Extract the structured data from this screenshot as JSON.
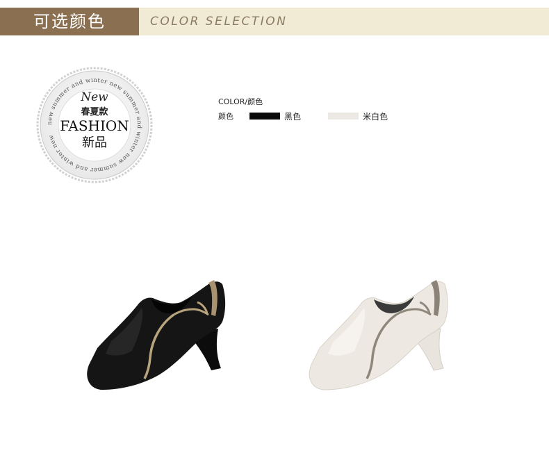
{
  "banner": {
    "title_cn": "可选颜色",
    "title_en": "COLOR SELECTION"
  },
  "badge": {
    "ring_text": "new summer and winter new summer and winter new summer and winter new",
    "new": "New",
    "season": "春夏款",
    "fashion": "FASHION",
    "new_cn": "新品"
  },
  "colors": {
    "title": "COLOR/颜色",
    "label": "颜色",
    "options": [
      {
        "name": "黑色",
        "swatch": "#0a0a0a"
      },
      {
        "name": "米白色",
        "swatch": "#ece9e4"
      }
    ]
  }
}
